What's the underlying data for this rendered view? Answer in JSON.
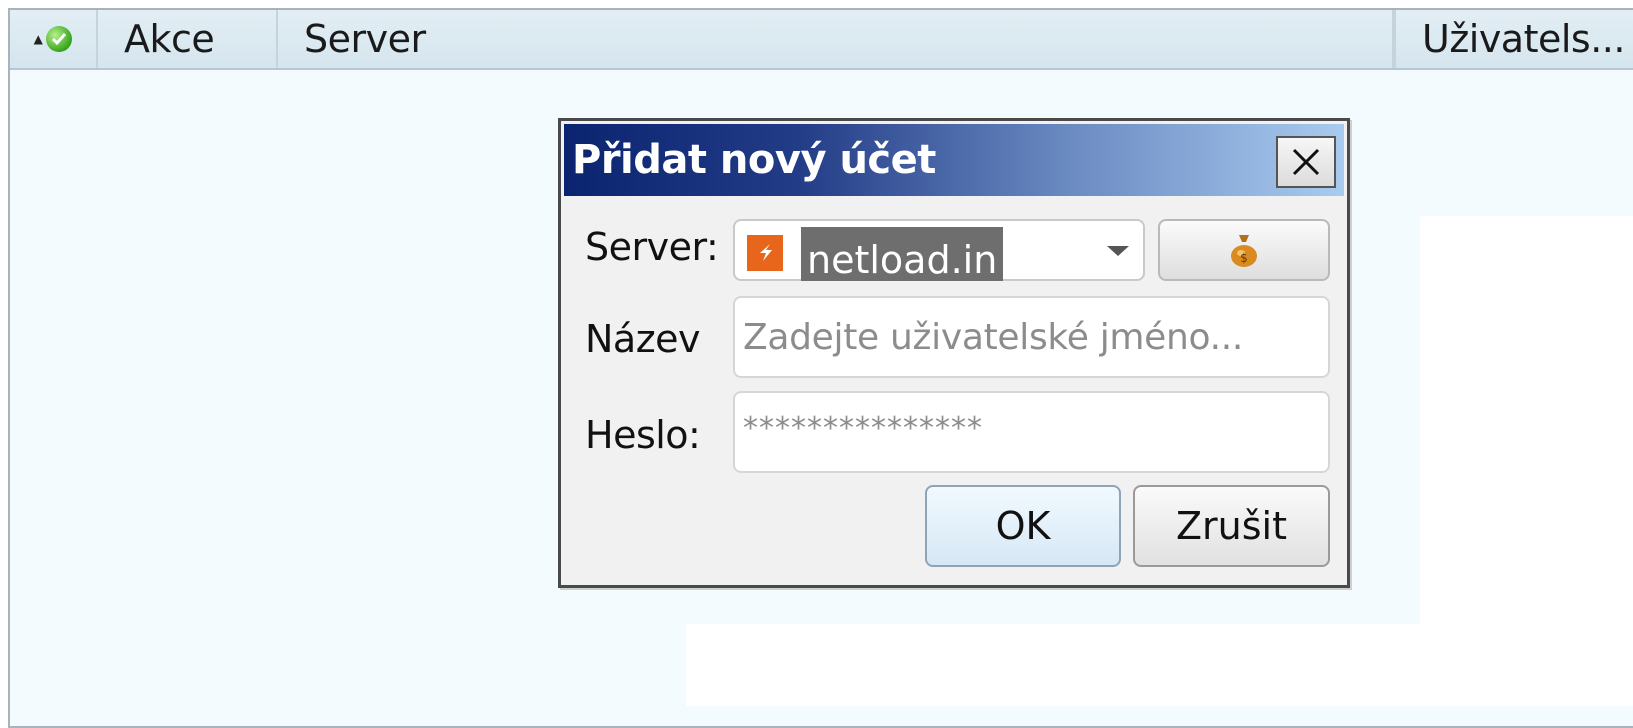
{
  "table": {
    "columns": {
      "akce": "Akce",
      "server": "Server",
      "user": "Uživatels..."
    },
    "status_icon": "check-circle-icon",
    "sort_indicator": "▲"
  },
  "dialog": {
    "title": "Přidat nový účet",
    "close_icon": "close-icon",
    "server_label": "Server:",
    "server_value": "netload.in",
    "server_icon": "netload-logo-icon",
    "account_button_icon": "money-bag-icon",
    "name_label": "Název",
    "name_placeholder": "Zadejte uživatelské jméno...",
    "password_label": "Heslo:",
    "password_value": "***************",
    "ok_label": "OK",
    "cancel_label": "Zrušit"
  }
}
